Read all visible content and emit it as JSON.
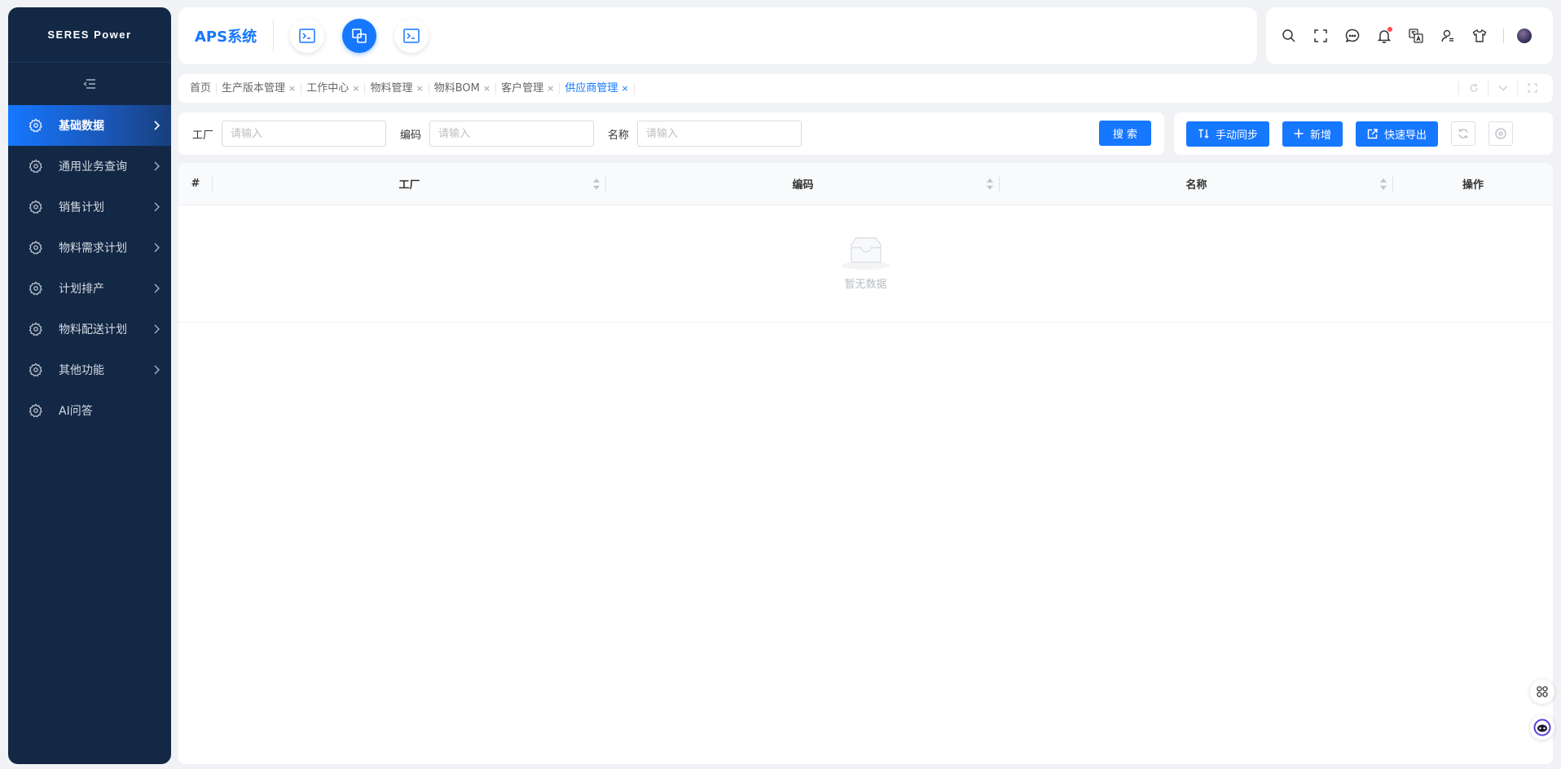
{
  "sidebar": {
    "brand": "SERES Power",
    "items": [
      {
        "label": "基础数据",
        "active": true,
        "has_children": true
      },
      {
        "label": "通用业务查询",
        "active": false,
        "has_children": true
      },
      {
        "label": "销售计划",
        "active": false,
        "has_children": true
      },
      {
        "label": "物料需求计划",
        "active": false,
        "has_children": true
      },
      {
        "label": "计划排产",
        "active": false,
        "has_children": true
      },
      {
        "label": "物料配送计划",
        "active": false,
        "has_children": true
      },
      {
        "label": "其他功能",
        "active": false,
        "has_children": true
      },
      {
        "label": "AI问答",
        "active": false,
        "has_children": false
      }
    ]
  },
  "header": {
    "app_title": "APS系统",
    "quick_buttons": [
      "terminal-icon",
      "copy-windows-icon",
      "terminal-icon"
    ],
    "tools": [
      "search-icon",
      "fullscreen-icon",
      "chat-icon",
      "bell-icon",
      "translate-icon",
      "user-settings-icon",
      "theme-shirt-icon"
    ]
  },
  "tabs": {
    "items": [
      {
        "label": "首页",
        "closable": false,
        "active": false
      },
      {
        "label": "生产版本管理",
        "closable": true,
        "active": false
      },
      {
        "label": "工作中心",
        "closable": true,
        "active": false
      },
      {
        "label": "物料管理",
        "closable": true,
        "active": false
      },
      {
        "label": "物料BOM",
        "closable": true,
        "active": false
      },
      {
        "label": "客户管理",
        "closable": true,
        "active": false
      },
      {
        "label": "供应商管理",
        "closable": true,
        "active": true
      }
    ],
    "close_glyph": "×"
  },
  "search": {
    "fields": [
      {
        "label": "工厂",
        "placeholder": "请输入",
        "value": ""
      },
      {
        "label": "编码",
        "placeholder": "请输入",
        "value": ""
      },
      {
        "label": "名称",
        "placeholder": "请输入",
        "value": ""
      }
    ],
    "search_button": "搜 索"
  },
  "actions": {
    "sync": "手动同步",
    "add": "新增",
    "export": "快速导出"
  },
  "table": {
    "columns": [
      "#",
      "工厂",
      "编码",
      "名称",
      "操作"
    ],
    "rows": [],
    "empty_text": "暂无数据"
  },
  "colors": {
    "primary": "#1677ff",
    "sidebar_bg": "#132845",
    "notification_dot": "#ff4d4f"
  }
}
